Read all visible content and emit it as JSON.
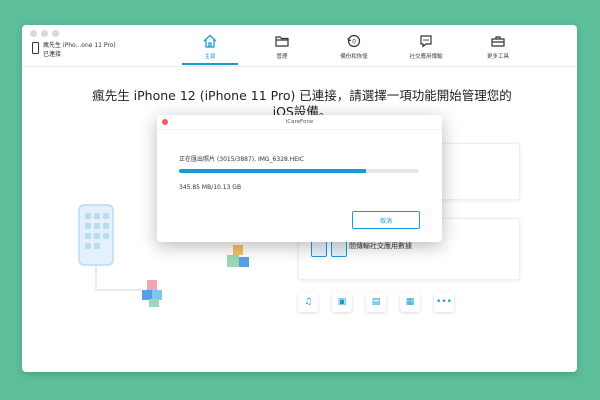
{
  "window": {
    "device": {
      "name": "瘋先生 iPho...one 11 Pro)",
      "status": "已連接"
    },
    "nav": [
      {
        "label": "主頁",
        "icon": "home-icon",
        "active": true
      },
      {
        "label": "管理",
        "icon": "folder-icon",
        "active": false
      },
      {
        "label": "備份和恢復",
        "icon": "backup-icon",
        "active": false
      },
      {
        "label": "社交應用傳輸",
        "icon": "chat-icon",
        "active": false
      },
      {
        "label": "更多工具",
        "icon": "toolbox-icon",
        "active": false
      }
    ],
    "headline": "瘋先生 iPhone 12 (iPhone 11 Pro) 已連接，請選擇一項功能開始管理您的iOS設備。",
    "card2_text": "間傳輸社交應用數據",
    "tools": [
      "music-icon",
      "photo-icon",
      "contacts-icon",
      "apps-icon",
      "more-icon"
    ]
  },
  "dialog": {
    "title": "iCareFone",
    "status": "正在匯出照片 (3015/3887), IMG_6328.HEIC",
    "progress": 0.78,
    "size": "345.85 MB/10.13 GB",
    "cancel_label": "取消"
  },
  "colors": {
    "accent": "#1a9bd7",
    "background": "#5dbf9a",
    "close": "#f35b57"
  }
}
